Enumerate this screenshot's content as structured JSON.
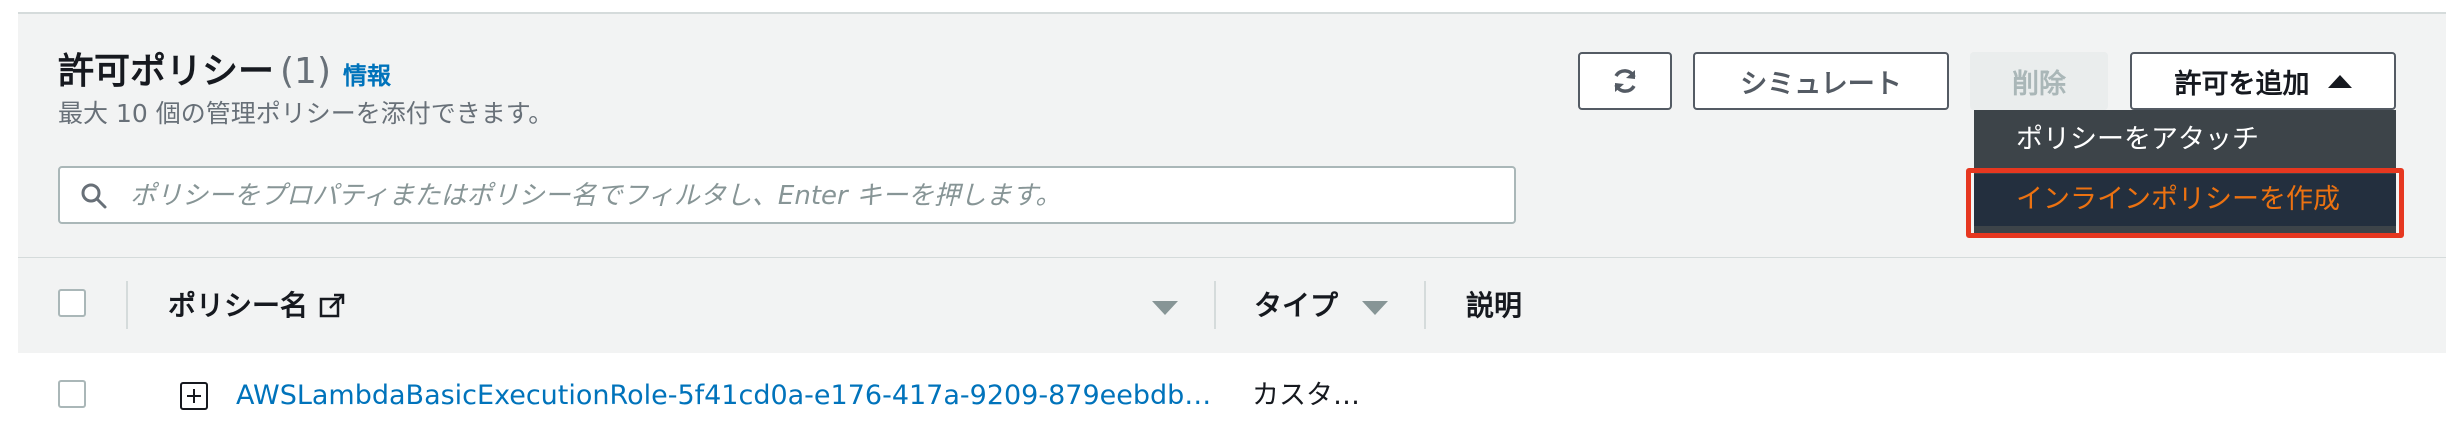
{
  "header": {
    "title": "許可ポリシー",
    "count": "(1)",
    "info_link": "情報",
    "subtitle": "最大 10 個の管理ポリシーを添付できます。"
  },
  "search": {
    "placeholder": "ポリシーをプロパティまたはポリシー名でフィルタし、Enter キーを押します。"
  },
  "toolbar": {
    "simulate_label": "シミュレート",
    "delete_label": "削除",
    "add_permissions_label": "許可を追加"
  },
  "dropdown": {
    "items": [
      {
        "label": "ポリシーをアタッチ"
      },
      {
        "label": "インラインポリシーを作成"
      }
    ]
  },
  "table": {
    "columns": [
      {
        "label": "ポリシー名"
      },
      {
        "label": "タイプ"
      },
      {
        "label": "説明"
      }
    ],
    "rows": [
      {
        "policy_name": "AWSLambdaBasicExecutionRole-5f41cd0a-e176-417a-9209-879eebdb…",
        "type": "カスタ…",
        "description": ""
      }
    ]
  },
  "colors": {
    "link": "#0073bb",
    "highlight_border": "#e63720",
    "menu_bg": "#3d4449",
    "menu_active_text": "#ec7211"
  },
  "icons": [
    "search-icon",
    "refresh-icon",
    "caret-up-icon",
    "external-link-icon",
    "sort-down-icon",
    "expand-plus-icon"
  ]
}
